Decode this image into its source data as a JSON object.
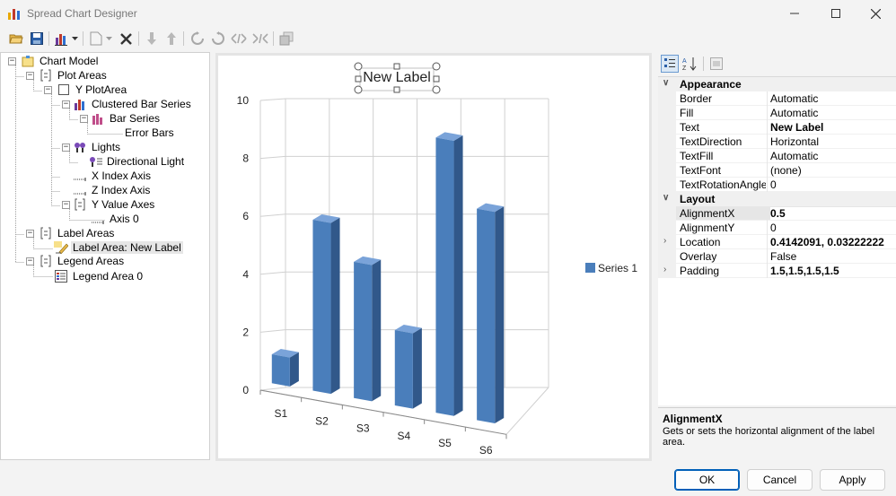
{
  "window": {
    "title": "Spread Chart Designer"
  },
  "tree": {
    "nodes": [
      {
        "label": "Chart Model"
      },
      {
        "label": "Plot Areas"
      },
      {
        "label": "Y PlotArea"
      },
      {
        "label": "Clustered Bar Series"
      },
      {
        "label": "Bar Series"
      },
      {
        "label": "Error Bars"
      },
      {
        "label": "Lights"
      },
      {
        "label": "Directional Light"
      },
      {
        "label": "X Index Axis"
      },
      {
        "label": "Z Index Axis"
      },
      {
        "label": "Y Value Axes"
      },
      {
        "label": "Axis 0"
      },
      {
        "label": "Label Areas"
      },
      {
        "label": "Label Area: New Label"
      },
      {
        "label": "Legend Areas"
      },
      {
        "label": "Legend Area 0"
      }
    ]
  },
  "chart_data": {
    "type": "bar",
    "title": "New Label",
    "categories": [
      "S1",
      "S2",
      "S3",
      "S4",
      "S5",
      "S6"
    ],
    "series": [
      {
        "name": "Series 1",
        "values": [
          1,
          5.9,
          4.7,
          2.6,
          9.5,
          7.3
        ],
        "color": "#4a7ebb"
      }
    ],
    "yticks": [
      "0",
      "2",
      "4",
      "6",
      "8",
      "10"
    ],
    "ylim": [
      0,
      10
    ],
    "grid": true,
    "legend": "right"
  },
  "properties": {
    "appearance_label": "Appearance",
    "appearance": [
      {
        "name": "Border",
        "value": "Automatic"
      },
      {
        "name": "Fill",
        "value": "Automatic"
      },
      {
        "name": "Text",
        "value": "New Label"
      },
      {
        "name": "TextDirection",
        "value": "Horizontal"
      },
      {
        "name": "TextFill",
        "value": "Automatic"
      },
      {
        "name": "TextFont",
        "value": "(none)"
      },
      {
        "name": "TextRotationAngle",
        "value": "0"
      }
    ],
    "layout_label": "Layout",
    "layout": [
      {
        "name": "AlignmentX",
        "value": "0.5"
      },
      {
        "name": "AlignmentY",
        "value": "0"
      },
      {
        "name": "Location",
        "value": "0.4142091, 0.03222222"
      },
      {
        "name": "Overlay",
        "value": "False"
      },
      {
        "name": "Padding",
        "value": "1.5,1.5,1.5,1.5"
      }
    ]
  },
  "description": {
    "title": "AlignmentX",
    "text": "Gets or sets the horizontal alignment of the label area."
  },
  "buttons": {
    "ok": "OK",
    "cancel": "Cancel",
    "apply": "Apply"
  }
}
